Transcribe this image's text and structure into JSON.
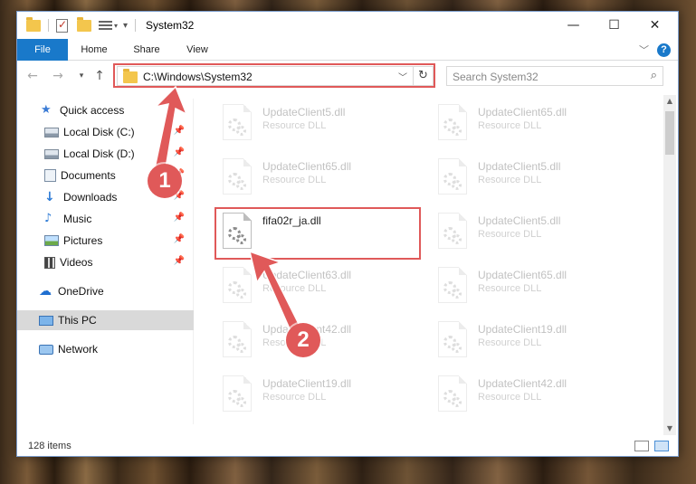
{
  "window": {
    "title": "System32"
  },
  "titlebar": {
    "minimize": "—",
    "maximize": "☐",
    "close": "✕"
  },
  "ribbon": {
    "tabs": [
      {
        "label": "File"
      },
      {
        "label": "Home"
      },
      {
        "label": "Share"
      },
      {
        "label": "View"
      }
    ],
    "help": "?"
  },
  "nav": {
    "address": "C:\\Windows\\System32",
    "search_placeholder": "Search System32"
  },
  "sidebar": {
    "items": [
      {
        "label": "Quick access",
        "icon": "star-icon"
      },
      {
        "label": "Local Disk (C:)",
        "icon": "drive-icon"
      },
      {
        "label": "Local Disk (D:)",
        "icon": "drive-icon"
      },
      {
        "label": "Documents",
        "icon": "documents-icon"
      },
      {
        "label": "Downloads",
        "icon": "download-icon"
      },
      {
        "label": "Music",
        "icon": "music-icon"
      },
      {
        "label": "Pictures",
        "icon": "pictures-icon"
      },
      {
        "label": "Videos",
        "icon": "videos-icon"
      },
      {
        "label": "OneDrive",
        "icon": "cloud-icon"
      },
      {
        "label": "This PC",
        "icon": "computer-icon"
      },
      {
        "label": "Network",
        "icon": "network-icon"
      }
    ]
  },
  "files": [
    {
      "name": "UpdateClient5.dll",
      "type": "Resource DLL"
    },
    {
      "name": "UpdateClient65.dll",
      "type": "Resource DLL"
    },
    {
      "name": "UpdateClient65.dll",
      "type": "Resource DLL"
    },
    {
      "name": "UpdateClient5.dll",
      "type": "Resource DLL"
    },
    {
      "name": "fifa02r_ja.dll",
      "type": ""
    },
    {
      "name": "UpdateClient5.dll",
      "type": "Resource DLL"
    },
    {
      "name": "UpdateClient63.dll",
      "type": "Resource DLL"
    },
    {
      "name": "UpdateClient65.dll",
      "type": "Resource DLL"
    },
    {
      "name": "UpdateClient42.dll",
      "type": "Resource DLL"
    },
    {
      "name": "UpdateClient19.dll",
      "type": "Resource DLL"
    },
    {
      "name": "UpdateClient19.dll",
      "type": "Resource DLL"
    },
    {
      "name": "UpdateClient42.dll",
      "type": "Resource DLL"
    }
  ],
  "status": {
    "item_count": "128 items"
  },
  "annotations": {
    "step1": "1",
    "step2": "2",
    "accent": "#e05959"
  }
}
